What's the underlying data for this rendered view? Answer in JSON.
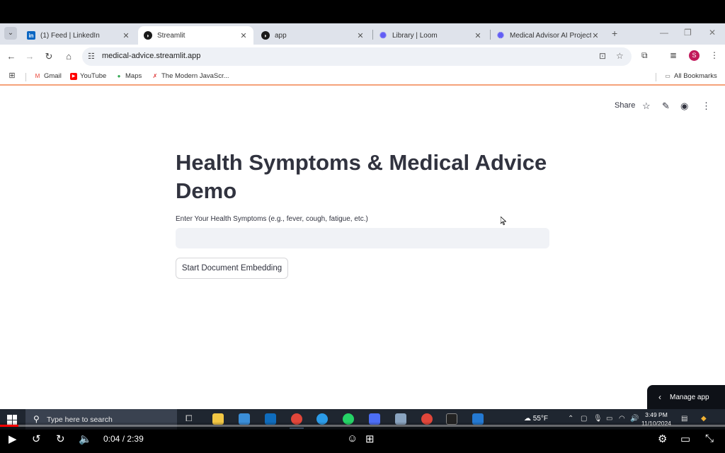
{
  "browser": {
    "tabs": [
      {
        "title": "(1) Feed | LinkedIn",
        "favicon": "linkedin-icon",
        "active": false
      },
      {
        "title": "Streamlit",
        "favicon": "streamlit-icon",
        "active": true
      },
      {
        "title": "app",
        "favicon": "streamlit-icon",
        "active": false
      },
      {
        "title": "Library | Loom",
        "favicon": "loom-icon",
        "active": false
      },
      {
        "title": "Medical Advisor AI Project C",
        "favicon": "loom-icon",
        "active": false
      }
    ],
    "url": "medical-advice.streamlit.app",
    "bookmarks": [
      "Gmail",
      "YouTube",
      "Maps",
      "The Modern JavaScr..."
    ],
    "all_bookmarks": "All Bookmarks",
    "profile_initial": "S"
  },
  "streamlit": {
    "share_label": "Share",
    "title": "Health Symptoms & Medical Advice Demo",
    "input_label": "Enter Your Health Symptoms (e.g., fever, cough, fatigue, etc.)",
    "input_value": "",
    "button_label": "Start Document Embedding",
    "manage_app": "Manage app"
  },
  "taskbar": {
    "search_placeholder": "Type here to search",
    "weather": "55°F",
    "time": "3:49 PM",
    "date": "11/10/2024"
  },
  "player": {
    "current_time": "0:04",
    "separator": "/",
    "duration": "2:39",
    "progress_fraction": 0.025
  },
  "colors": {
    "accent_red": "#ff0000",
    "streamlit_text": "#31333f",
    "input_bg": "#f0f2f6",
    "tab_strip": "#dfe3eb"
  }
}
